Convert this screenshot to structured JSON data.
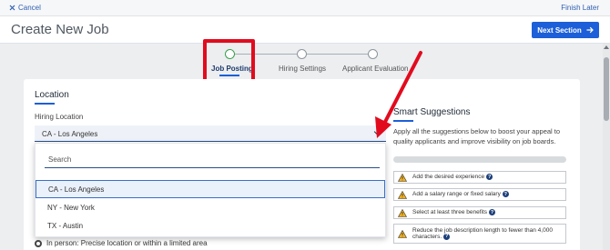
{
  "topbar": {
    "cancel_label": "Cancel",
    "finish_label": "Finish Later"
  },
  "header": {
    "title": "Create New Job",
    "next_label": "Next Section"
  },
  "stepper": {
    "steps": [
      {
        "label": "Job Posting",
        "active": true
      },
      {
        "label": "Hiring Settings",
        "active": false
      },
      {
        "label": "Applicant Evaluation",
        "active": false
      }
    ]
  },
  "location": {
    "section_title": "Location",
    "field_label": "Hiring Location",
    "selected_value": "CA - Los Angeles",
    "search_placeholder": "Search",
    "options": [
      "CA - Los Angeles",
      "NY - New York",
      "TX - Austin"
    ],
    "radio_label": "In person: Precise location or within a limited area"
  },
  "suggestions": {
    "title": "Smart Suggestions",
    "description": "Apply all the suggestions below to boost your appeal to quality applicants and improve visibility on job boards.",
    "progress": 0,
    "items": [
      "Add the desired experience",
      "Add a salary range or fixed salary",
      "Select at least three benefits",
      "Reduce the job description length to fewer than 4,000 characters."
    ]
  },
  "colors": {
    "accent": "#1c5fd8",
    "highlight": "#e20b1e",
    "active_step": "#37a04a",
    "warning": "#f2b01e"
  }
}
